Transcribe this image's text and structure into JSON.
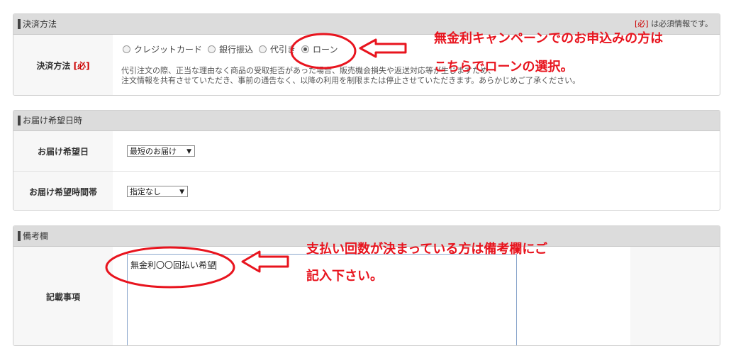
{
  "payment": {
    "section_title": "決済方法",
    "required_mark": "[必]",
    "required_note": "は必須情報です。",
    "row_label": "決済方法",
    "row_required": "[必]",
    "options": [
      {
        "label": "クレジットカード",
        "checked": false
      },
      {
        "label": "銀行振込",
        "checked": false
      },
      {
        "label": "代引き",
        "checked": false
      },
      {
        "label": "ローン",
        "checked": true
      }
    ],
    "note_line1": "代引注文の際、正当な理由なく商品の受取拒否があった場合、販売機会損失や返送対応等が生じますため、",
    "note_line2": "注文情報を共有させていただき、事前の通告なく、以降の利用を制限または停止させていただきます。あらかじめご了承ください。"
  },
  "delivery": {
    "section_title": "お届け希望日時",
    "date_label": "お届け希望日",
    "date_value": "最短のお届け",
    "time_label": "お届け希望時間帯",
    "time_value": "指定なし"
  },
  "remarks": {
    "section_title": "備考欄",
    "field_label": "記載事項",
    "field_value": "無金利〇〇回払い希望"
  },
  "annotations": {
    "top_line1": "無金利キャンペーンでのお申込みの方は",
    "top_line2": "こちらでローンの選択。",
    "bottom_line1": "支払い回数が決まっている方は備考欄にご",
    "bottom_line2": "記入下さい。",
    "color": "#e8141e"
  },
  "icons": {
    "select_arrow": "▼"
  }
}
